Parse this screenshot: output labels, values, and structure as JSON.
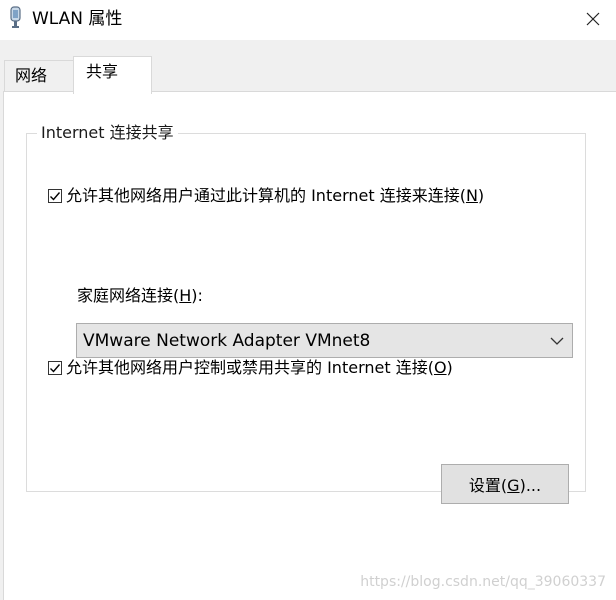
{
  "window": {
    "title": "WLAN 属性",
    "icon": "network-adapter-icon",
    "close_icon": "close-icon"
  },
  "tabs": [
    {
      "label": "网络",
      "active": false
    },
    {
      "label": "共享",
      "active": true
    }
  ],
  "group": {
    "legend": "Internet 连接共享"
  },
  "allow_connect": {
    "checked": true,
    "label_prefix": "允许其他网络用户通过此计算机的 Internet 连接来连接(",
    "mnemonic": "N",
    "label_suffix": ")"
  },
  "home_network": {
    "label_prefix": "家庭网络连接(",
    "mnemonic": "H",
    "label_suffix": "):",
    "selected": "VMware Network Adapter VMnet8"
  },
  "allow_control": {
    "checked": true,
    "label_prefix": "允许其他网络用户控制或禁用共享的 Internet 连接(",
    "mnemonic": "O",
    "label_suffix": ")"
  },
  "settings_button": {
    "label_prefix": "设置(",
    "mnemonic": "G",
    "label_suffix": ")..."
  },
  "watermark": "https://blog.csdn.net/qq_39060337"
}
